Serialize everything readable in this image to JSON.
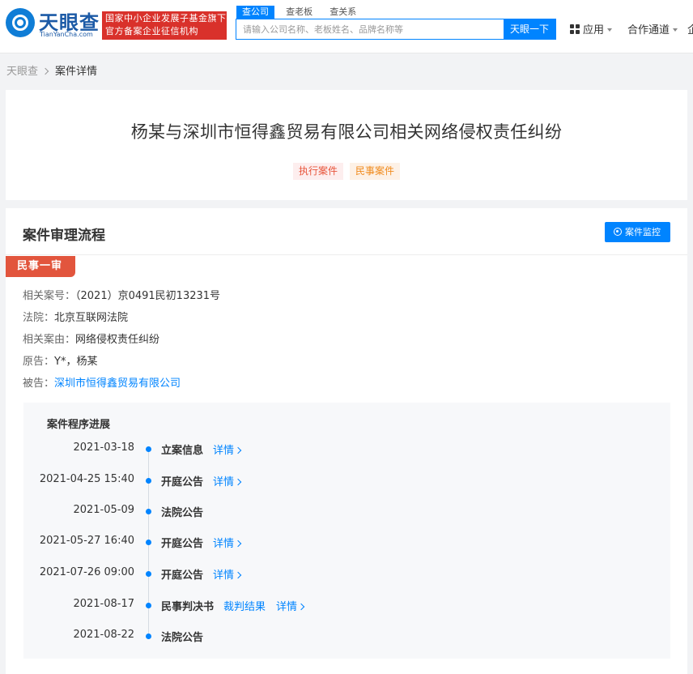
{
  "header": {
    "logo_text": "天眼查",
    "logo_sub": "TianYanCha.com",
    "badge_line1": "国家中小企业发展子基金旗下",
    "badge_line2": "官方备案企业征信机构",
    "search_tabs": [
      "查公司",
      "查老板",
      "查关系"
    ],
    "search_placeholder": "请输入公司名称、老板姓名、品牌名称等",
    "search_button": "天眼一下",
    "nav_apps": "应用",
    "nav_partner": "合作通道",
    "nav_clipped": "企"
  },
  "breadcrumb": {
    "home": "天眼查",
    "current": "案件详情"
  },
  "case": {
    "title": "杨某与深圳市恒得鑫贸易有限公司相关网络侵权责任纠纷",
    "tags": [
      "执行案件",
      "民事案件"
    ]
  },
  "process": {
    "section_title": "案件审理流程",
    "monitor_button": "案件监控",
    "stage": "民事一审",
    "info": {
      "case_no_label": "相关案号：",
      "case_no": "（2021）京0491民初13231号",
      "court_label": "法院：",
      "court": "北京互联网法院",
      "cause_label": "相关案由：",
      "cause": "网络侵权责任纠纷",
      "plaintiff_label": "原告：",
      "plaintiff": "Y*，杨某",
      "defendant_label": "被告：",
      "defendant": "深圳市恒得鑫贸易有限公司"
    },
    "progress_title": "案件程序进展",
    "timeline": [
      {
        "date": "2021-03-18",
        "event": "立案信息",
        "links": [
          "详情"
        ]
      },
      {
        "date": "2021-04-25 15:40",
        "event": "开庭公告",
        "links": [
          "详情"
        ]
      },
      {
        "date": "2021-05-09",
        "event": "法院公告",
        "links": []
      },
      {
        "date": "2021-05-27 16:40",
        "event": "开庭公告",
        "links": [
          "详情"
        ]
      },
      {
        "date": "2021-07-26 09:00",
        "event": "开庭公告",
        "links": [
          "详情"
        ]
      },
      {
        "date": "2021-08-17",
        "event": "民事判决书",
        "links": [
          "裁判结果",
          "详情"
        ]
      },
      {
        "date": "2021-08-22",
        "event": "法院公告",
        "links": []
      }
    ]
  }
}
